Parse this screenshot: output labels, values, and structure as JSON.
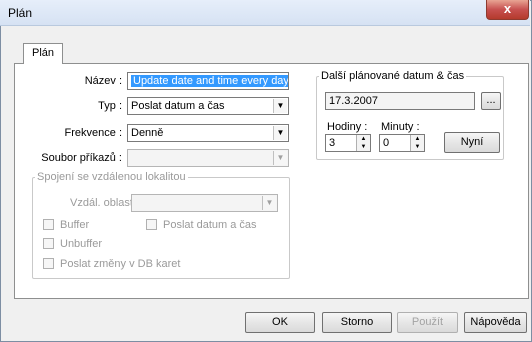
{
  "window": {
    "title": "Plán",
    "close_label": "x"
  },
  "tabs": [
    {
      "label": "Plán"
    }
  ],
  "form": {
    "name_label": "Název :",
    "name_value": "Update date and time every day",
    "type_label": "Typ :",
    "type_value": "Poslat datum a čas",
    "frequency_label": "Frekvence :",
    "frequency_value": "Denně",
    "command_file_label": "Soubor příkazů :",
    "command_file_value": ""
  },
  "remote": {
    "legend": "Spojení se vzdálenou lokalitou",
    "area_label": "Vzdál. oblast :",
    "area_value": "",
    "buffer_label": "Buffer",
    "send_datetime_label": "Poslat datum a čas",
    "unbuffer_label": "Unbuffer",
    "send_changes_label": "Poslat změny v DB karet"
  },
  "schedule": {
    "legend": "Další plánované datum & čas",
    "date_value": "17.3.2007",
    "browse_label": "...",
    "hours_label": "Hodiny :",
    "hours_value": "3",
    "minutes_label": "Minuty :",
    "minutes_value": "0",
    "now_label": "Nyní"
  },
  "footer": {
    "ok": "OK",
    "cancel": "Storno",
    "apply": "Použít",
    "help": "Nápověda"
  },
  "icons": {
    "dropdown": "chevron-down-icon",
    "spin": "spin-arrows-icon"
  }
}
